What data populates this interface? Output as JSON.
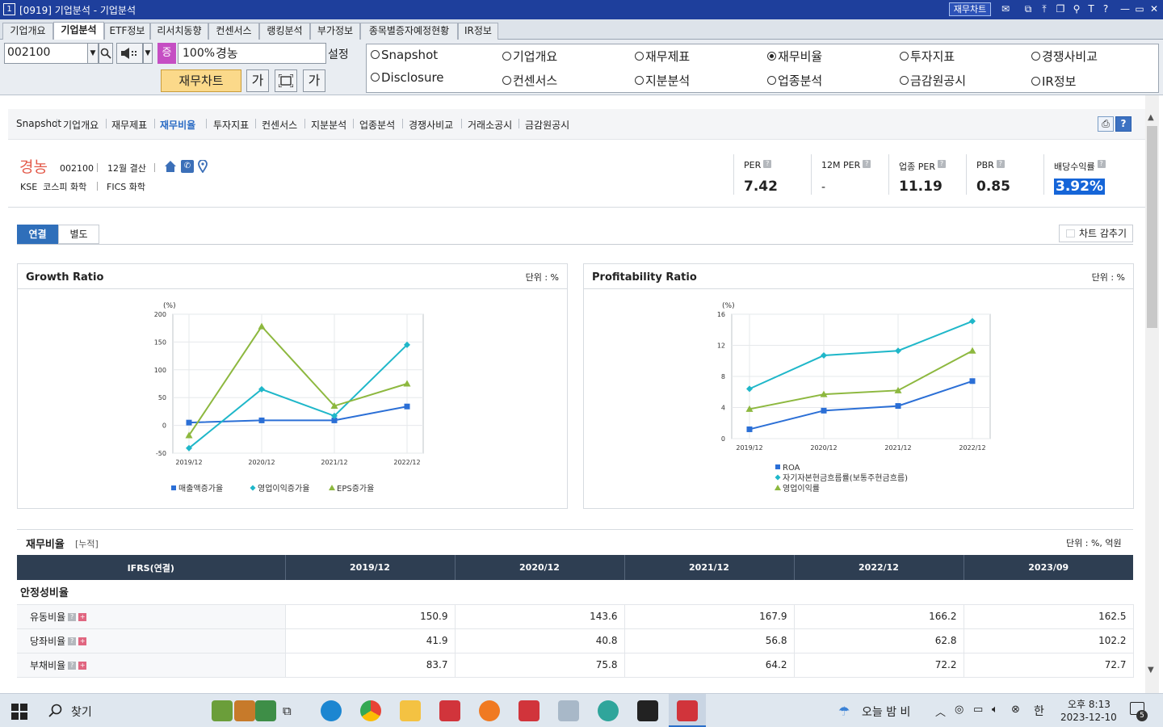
{
  "window": {
    "id": "1",
    "title": "[0919] 기업분석 - 기업분석",
    "chart_btn": "재무차트"
  },
  "module_tabs": [
    {
      "label": "기업개요",
      "active": false
    },
    {
      "label": "기업분석",
      "active": true
    },
    {
      "label": "ETF정보",
      "active": false
    },
    {
      "label": "리서치동향",
      "active": false
    },
    {
      "label": "컨센서스",
      "active": false
    },
    {
      "label": "랭킹분석",
      "active": false
    },
    {
      "label": "부가정보",
      "active": false
    },
    {
      "label": "종목별증자예정현황",
      "active": false
    },
    {
      "label": "IR정보",
      "active": false
    }
  ],
  "controls": {
    "code": "002100",
    "badge": "증",
    "percent": "100%",
    "name": "경농",
    "setting": "설정",
    "finchart_btn": "재무차트",
    "ga1": "가",
    "ga2": "가"
  },
  "radio_options": [
    {
      "label": "Snapshot",
      "checked": false
    },
    {
      "label": "기업개요",
      "checked": false
    },
    {
      "label": "재무제표",
      "checked": false
    },
    {
      "label": "재무비율",
      "checked": true
    },
    {
      "label": "투자지표",
      "checked": false
    },
    {
      "label": "경쟁사비교",
      "checked": false
    },
    {
      "label": "Disclosure",
      "checked": false
    },
    {
      "label": "컨센서스",
      "checked": false
    },
    {
      "label": "지분분석",
      "checked": false
    },
    {
      "label": "업종분석",
      "checked": false
    },
    {
      "label": "금감원공시",
      "checked": false
    },
    {
      "label": "IR정보",
      "checked": false
    }
  ],
  "subnav": [
    {
      "label": "Snapshot",
      "active": false
    },
    {
      "label": "기업개요",
      "active": false
    },
    {
      "label": "재무제표",
      "active": false
    },
    {
      "label": "재무비율",
      "active": true
    },
    {
      "label": "투자지표",
      "active": false
    },
    {
      "label": "컨센서스",
      "active": false
    },
    {
      "label": "지분분석",
      "active": false
    },
    {
      "label": "업종분석",
      "active": false
    },
    {
      "label": "경쟁사비교",
      "active": false
    },
    {
      "label": "거래소공시",
      "active": false
    },
    {
      "label": "금감원공시",
      "active": false
    }
  ],
  "company": {
    "name": "경농",
    "code": "002100",
    "fiscal": "12월 결산",
    "market": "KSE  코스피 화학",
    "fics": "FICS 화학"
  },
  "metrics": [
    {
      "label": "PER",
      "value": "7.42"
    },
    {
      "label": "12M PER",
      "value": "-"
    },
    {
      "label": "업종 PER",
      "value": "11.19"
    },
    {
      "label": "PBR",
      "value": "0.85"
    },
    {
      "label": "배당수익률",
      "value": "3.92%"
    }
  ],
  "view_tabs": {
    "consolidated": "연결",
    "separate": "별도",
    "hide_chart": "차트 감추기"
  },
  "chart_data": [
    {
      "type": "line",
      "title": "Growth Ratio",
      "unit_label": "단위 : %",
      "ylabel": "(%)",
      "categories": [
        "2019/12",
        "2020/12",
        "2021/12",
        "2022/12"
      ],
      "ylim": [
        -50,
        200
      ],
      "yticks": [
        -50,
        0,
        50,
        100,
        150,
        200
      ],
      "series": [
        {
          "name": "매출액증가율",
          "values": [
            5,
            9,
            9,
            34
          ],
          "color": "#2b6fd6",
          "marker": "square"
        },
        {
          "name": "영업이익증가율",
          "values": [
            -41,
            65,
            17,
            145
          ],
          "color": "#1fb7c9",
          "marker": "diamond"
        },
        {
          "name": "EPS증가율",
          "values": [
            -18,
            178,
            35,
            75
          ],
          "color": "#8db83f",
          "marker": "triangle"
        }
      ]
    },
    {
      "type": "line",
      "title": "Profitability Ratio",
      "unit_label": "단위 : %",
      "ylabel": "(%)",
      "categories": [
        "2019/12",
        "2020/12",
        "2021/12",
        "2022/12"
      ],
      "ylim": [
        0,
        16
      ],
      "yticks": [
        0,
        4,
        8,
        12,
        16
      ],
      "series": [
        {
          "name": "ROA",
          "values": [
            1.2,
            3.6,
            4.2,
            7.4
          ],
          "color": "#2b6fd6",
          "marker": "square"
        },
        {
          "name": "자기자본현금흐름률(보통주현금흐름)",
          "values": [
            6.4,
            10.7,
            11.3,
            15.1
          ],
          "color": "#1fb7c9",
          "marker": "diamond"
        },
        {
          "name": "영업이익률",
          "values": [
            3.8,
            5.7,
            6.2,
            11.3
          ],
          "color": "#8db83f",
          "marker": "triangle"
        }
      ]
    }
  ],
  "ratio_table": {
    "title": "재무비율",
    "subtitle": "[누적]",
    "unit": "단위 : %, 억원",
    "header": "IFRS(연결)",
    "periods": [
      "2019/12",
      "2020/12",
      "2021/12",
      "2022/12",
      "2023/09"
    ],
    "section": "안정성비율",
    "rows": [
      {
        "label": "유동비율",
        "values": [
          "150.9",
          "143.6",
          "167.9",
          "166.2",
          "162.5"
        ]
      },
      {
        "label": "당좌비율",
        "values": [
          "41.9",
          "40.8",
          "56.8",
          "62.8",
          "102.2"
        ]
      },
      {
        "label": "부채비율",
        "values": [
          "83.7",
          "75.8",
          "64.2",
          "72.2",
          "72.7"
        ]
      }
    ]
  },
  "taskbar": {
    "search": "찾기",
    "weather": "오늘 밤 비",
    "ime": "한",
    "time": "오후 8:13",
    "date": "2023-12-10",
    "notif": "5"
  }
}
